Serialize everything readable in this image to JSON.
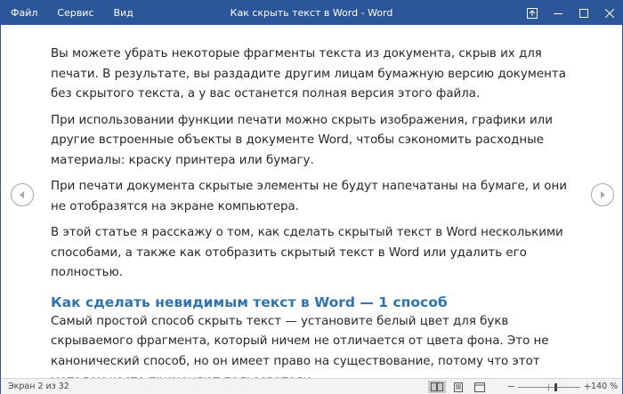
{
  "menu": [
    "Файл",
    "Сервис",
    "Вид"
  ],
  "window_title": "Как скрыть текст в Word  -  Word",
  "document": {
    "paragraphs": [
      "Вы можете убрать некоторые фрагменты текста из документа, скрыв их для печати. В результате, вы раздадите другим лицам бумажную версию документа без скрытого текста, а у вас останется полная версия этого файла.",
      "При использовании функции печати можно скрыть изображения, графики или другие встроенные объекты в документе Word, чтобы сэкономить расходные материалы: краску принтера или бумагу.",
      "При печати документа скрытые элементы не будут напечатаны на бумаге, и они не отобразятся на экране компьютера.",
      "В этой статье я расскажу о том, как сделать скрытый текст в Word несколькими способами, а также как отобразить скрытый текст в Word или удалить его полностью."
    ],
    "heading": "Как сделать невидимым текст в Word — 1 способ",
    "paragraph_after_heading": "Самый простой способ скрыть текст — установите белый цвет для букв скрываемого фрагмента, который ничем не отличается от цвета фона. Это не канонический способ, но он имеет право на существование, потому что этот методом часто применяют пользователи."
  },
  "status": {
    "page": "Экран 2 из 32",
    "zoom": "140 %",
    "zoom_fraction": 0.6
  },
  "colors": {
    "titlebar": "#2b579a",
    "heading": "#2e74b5",
    "text": "#262626"
  },
  "icons": {
    "ribbon": "ribbon-display-icon",
    "minimize": "minimize-icon",
    "maximize": "maximize-icon",
    "close": "close-icon",
    "prev": "chevron-left-icon",
    "next": "chevron-right-icon"
  }
}
